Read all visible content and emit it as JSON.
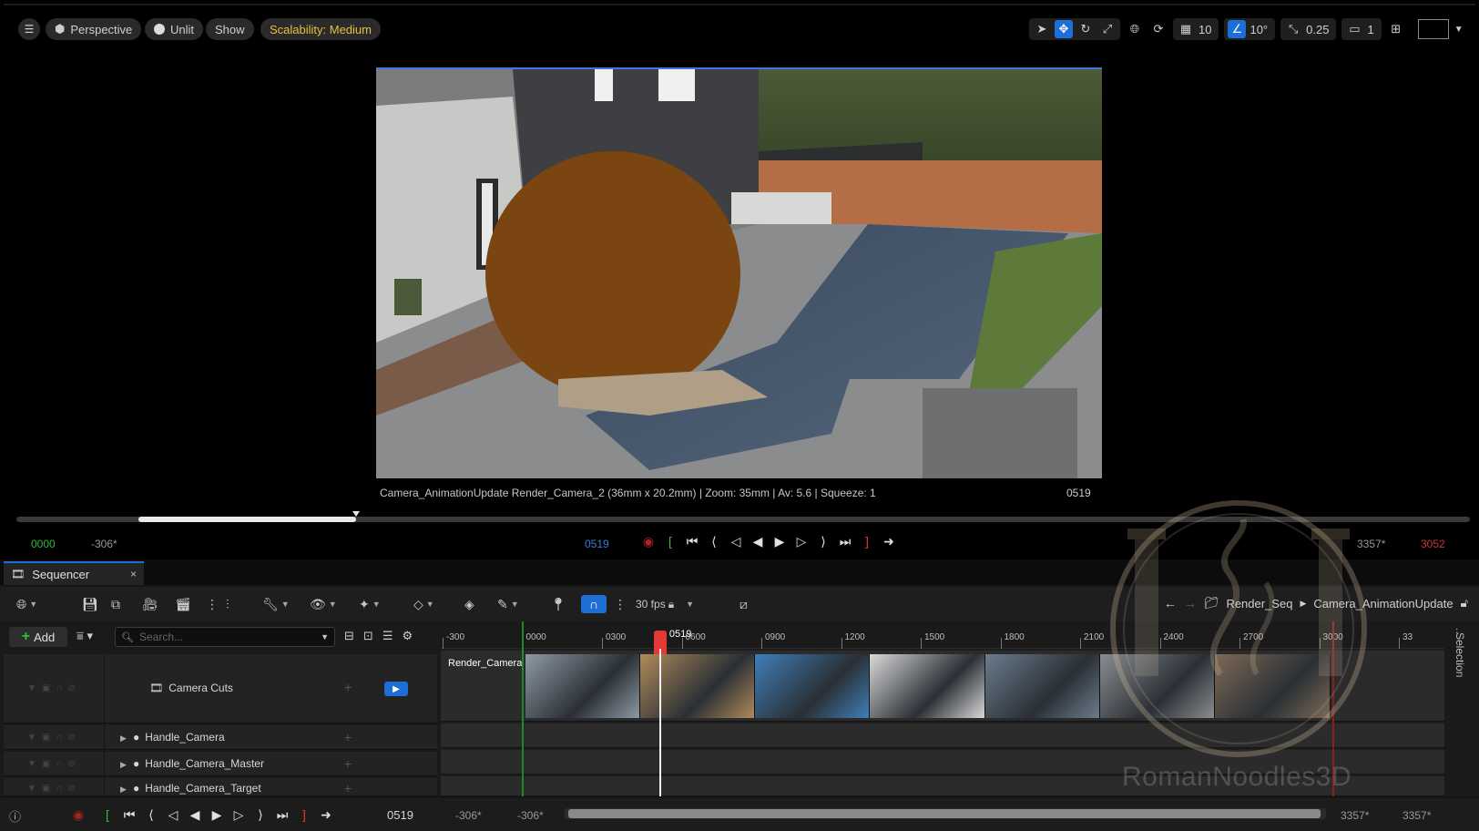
{
  "viewport": {
    "perspective_label": "Perspective",
    "lit_label": "Unlit",
    "show_label": "Show",
    "scalability_label": "Scalability: Medium",
    "grid_snap": "10",
    "rot_snap": "10°",
    "scale_snap": "0.25",
    "camera_speed": "1",
    "scene_info": "Camera_AnimationUpdate  Render_Camera_2 (36mm x 20.2mm) | Zoom: 35mm | Av: 5.6 | Squeeze: 1",
    "scene_frame": "0519",
    "progress_fraction": 0.15,
    "tc_start": "0000",
    "tc_neg": "-306*",
    "tc_current": "0519",
    "tc_end": "3357*",
    "tc_out": "3052"
  },
  "sequencer": {
    "tab_title": "Sequencer",
    "tab_close": "×",
    "fps_label": "30 fps",
    "breadcrumb": [
      "Render_Seq",
      "Camera_AnimationUpdate"
    ],
    "add_label": "Add",
    "search_placeholder": "Search...",
    "tracks": [
      {
        "label": "Camera Cuts"
      },
      {
        "label": "Handle_Camera"
      },
      {
        "label": "Handle_Camera_Master"
      },
      {
        "label": "Handle_Camera_Target"
      }
    ],
    "ruler_ticks": [
      "-300",
      "0000",
      "0300",
      "0600",
      "0900",
      "1200",
      "1500",
      "1800",
      "2100",
      "2400",
      "2700",
      "3000",
      "33"
    ],
    "playhead_label": "0519",
    "thumbnail_label": "Render_Camera",
    "footer": {
      "current": "0519",
      "view_start": "-306*",
      "play_start": "-306*",
      "play_end": "3357*",
      "view_end": "3357*"
    },
    "rail_label": "Selection"
  },
  "watermark": {
    "text": "RomanNoodles3D"
  },
  "colors": {
    "accent": "#1d6fd6",
    "playhead": "#e53935",
    "start_marker": "#1f8a1f",
    "end_marker": "#8a1f1f",
    "scalability": "#e6c040"
  }
}
